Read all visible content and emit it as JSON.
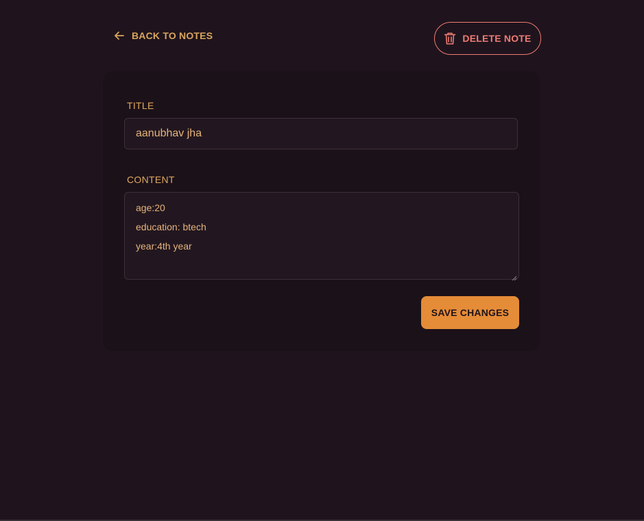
{
  "header": {
    "back_label": "BACK TO NOTES",
    "delete_label": "DELETE NOTE",
    "back_icon": "arrow-left-icon",
    "delete_icon": "trash-icon"
  },
  "form": {
    "title_label": "TITLE",
    "title_value": "aanubhav jha",
    "content_label": "CONTENT",
    "content_lines": [
      "age:20",
      "education: btech",
      "year:4th year"
    ],
    "save_label": "SAVE CHANGES"
  },
  "colors": {
    "background": "#1f141d",
    "card": "#1b1119",
    "accent": "#e58c38",
    "label": "#e0a85e",
    "danger": "#f07b74"
  }
}
